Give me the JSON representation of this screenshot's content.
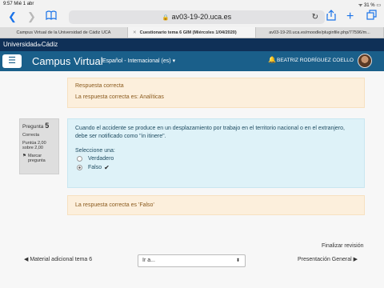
{
  "status_bar": {
    "time": "9:57",
    "date": "Mié 1 abr",
    "battery": "31 %"
  },
  "browser": {
    "url": "av03-19-20.uca.es",
    "tabs": [
      {
        "label": "Campus Virtual de la Universidad de Cádiz UCA",
        "active": false
      },
      {
        "label": "Cuestionario tema 6 GIM (Miércoles 1/04/2020)",
        "active": true
      },
      {
        "label": "av03-19-20.uca.es/moodle/pluginfile.php/77596/m...",
        "active": false
      }
    ]
  },
  "site": {
    "university": "Universidad",
    "university_small": "de",
    "university_end": "Cádiz",
    "campus_title": "Campus Virtual",
    "language": "Español - Internacional (es)",
    "user_name": "BEATRIZ RODRÍGUEZ COELLO"
  },
  "previous_feedback": {
    "status": "Respuesta correcta",
    "correct_answer": "La respuesta correcta es: Analíticas"
  },
  "question_info": {
    "label": "Pregunta",
    "number": "5",
    "state": "Correcta",
    "score": "Puntúa 2,00 sobre 2,00",
    "flag": "Marcar pregunta"
  },
  "question": {
    "text": "Cuando el accidente se produce en un desplazamiento por trabajo en el territorio nacional o en el extranjero, debe ser notificado como \"in itinere\".",
    "prompt": "Seleccione una:",
    "options": [
      {
        "label": "Verdadero",
        "selected": false
      },
      {
        "label": "Falso",
        "selected": true,
        "correct": true
      }
    ]
  },
  "feedback": {
    "correct_answer": "La respuesta correcta es 'Falso'"
  },
  "navigation": {
    "finish_review": "Finalizar revisión",
    "prev": "Material adicional tema 6",
    "jump_placeholder": "Ir a...",
    "next": "Presentación General"
  },
  "icons": {
    "back": "chevron-left-icon",
    "forward": "chevron-right-icon",
    "bookmarks": "book-icon",
    "share": "share-icon",
    "new_tab": "plus-icon",
    "tabs": "tabs-icon",
    "bell": "bell-icon",
    "check": "check-icon",
    "flag": "flag-icon"
  },
  "colors": {
    "campus_bar": "#1a5f8a",
    "uni_bar": "#0f3057",
    "feedback_bg": "#fcefdc",
    "question_bg": "#def2f8"
  }
}
